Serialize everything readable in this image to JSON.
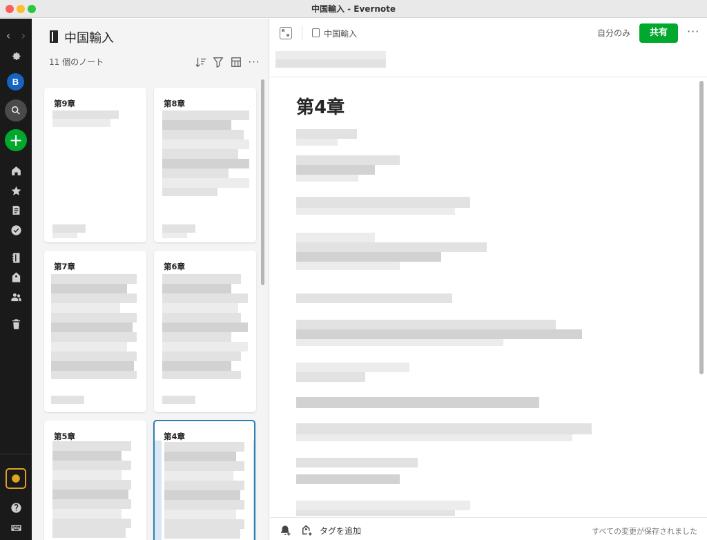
{
  "window": {
    "title": "中国輸入 - Evernote"
  },
  "sidebar": {
    "nav_back": "‹",
    "nav_forward": "›",
    "avatar_initial": "B",
    "new_label": "+",
    "icons": [
      "gear-icon",
      "search-icon",
      "plus-icon",
      "home-icon",
      "star-icon",
      "notes-icon",
      "tasks-icon",
      "notebook-icon",
      "tag-icon",
      "shared-icon",
      "trash-icon",
      "upgrade-icon",
      "help-icon",
      "keyboard-icon"
    ]
  },
  "notelist": {
    "title": "中国輸入",
    "count": "11 個のノート",
    "cards": [
      {
        "title": "第9章"
      },
      {
        "title": "第8章"
      },
      {
        "title": "第7章"
      },
      {
        "title": "第6章"
      },
      {
        "title": "第5章"
      },
      {
        "title": "第4章",
        "selected": true
      }
    ]
  },
  "editor": {
    "breadcrumb": "中国輸入",
    "visibility": "自分のみ",
    "share_label": "共有",
    "more_label": "···",
    "title": "第4章",
    "footer": {
      "tag_placeholder": "タグを追加",
      "status": "すべての変更が保存されました"
    }
  },
  "colors": {
    "accent_green": "#00a82d",
    "sidebar_bg": "#1a1a1a",
    "selected_border": "#2d7fb5",
    "upgrade_gold": "#e0a220"
  }
}
